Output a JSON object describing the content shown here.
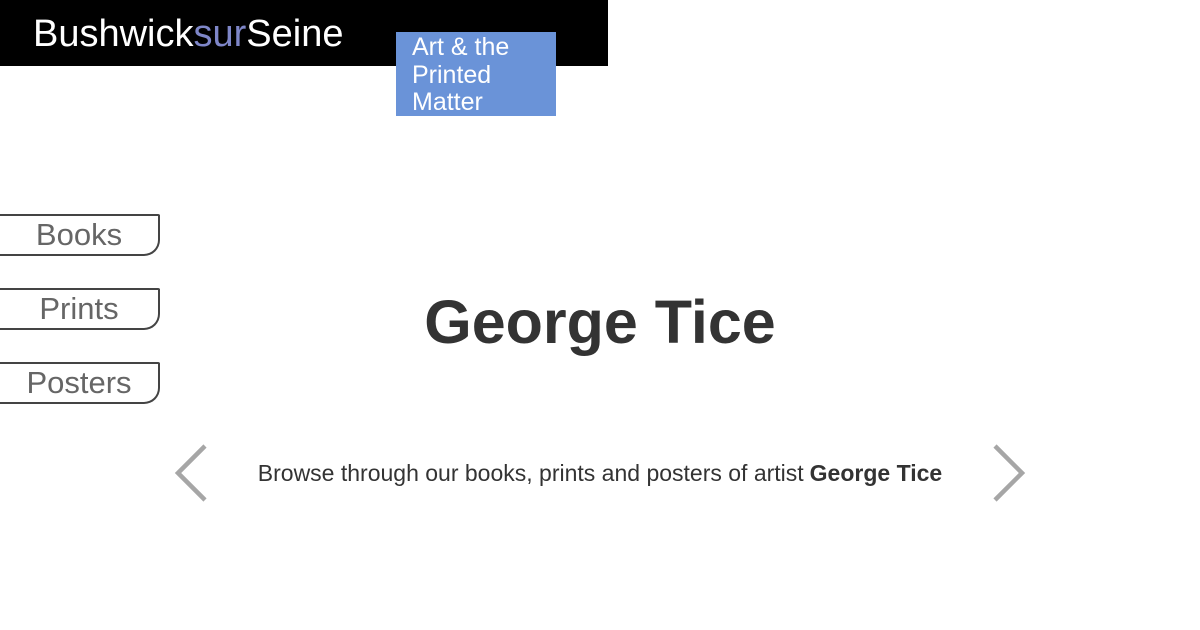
{
  "header": {
    "logo": {
      "part1": "Bushwick",
      "part2": "sur",
      "part3": "Seine"
    },
    "tagline_lines": [
      "Art & the",
      "Printed",
      "Matter"
    ]
  },
  "nav": {
    "items": [
      {
        "label": "Books"
      },
      {
        "label": "Prints"
      },
      {
        "label": "Posters"
      }
    ]
  },
  "main": {
    "title": "George Tice",
    "browse_text": "Browse through our books, prints and posters of artist",
    "browse_artist": "George Tice"
  },
  "carousel": {
    "prev_icon": "chevron-left-icon",
    "next_icon": "chevron-right-icon"
  },
  "colors": {
    "header_bg": "#000000",
    "logo_accent": "#7e86c8",
    "tagline_bg": "#6a93d8",
    "arrow_color": "#a6a6a6",
    "title_color": "#333333"
  }
}
